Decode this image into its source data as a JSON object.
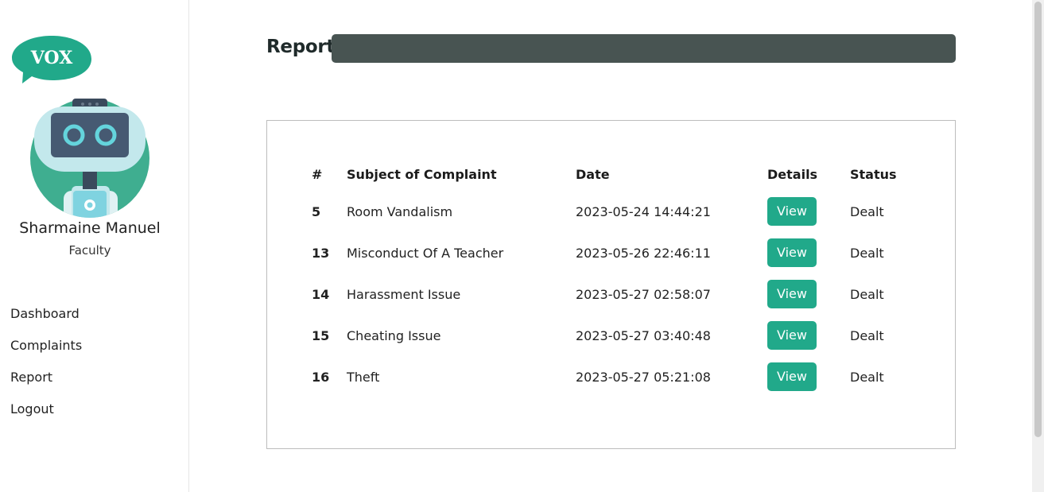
{
  "sidebar": {
    "logo_text": "VOX",
    "user_name": "Sharmaine Manuel",
    "user_role": "Faculty",
    "nav": [
      "Dashboard",
      "Complaints",
      "Report",
      "Logout"
    ]
  },
  "main": {
    "title": "Report",
    "table": {
      "headers": [
        "#",
        "Subject of Complaint",
        "Date",
        "Details",
        "Status"
      ],
      "rows": [
        {
          "id": "5",
          "subject": "Room Vandalism",
          "date": "2023-05-24 14:44:21",
          "details": "View",
          "status": "Dealt"
        },
        {
          "id": "13",
          "subject": "Misconduct Of A Teacher",
          "date": "2023-05-26 22:46:11",
          "details": "View",
          "status": "Dealt"
        },
        {
          "id": "14",
          "subject": "Harassment Issue",
          "date": "2023-05-27 02:58:07",
          "details": "View",
          "status": "Dealt"
        },
        {
          "id": "15",
          "subject": "Cheating Issue",
          "date": "2023-05-27 03:40:48",
          "details": "View",
          "status": "Dealt"
        },
        {
          "id": "16",
          "subject": "Theft",
          "date": "2023-05-27 05:21:08",
          "details": "View",
          "status": "Dealt"
        }
      ]
    }
  },
  "colors": {
    "accent": "#21a98a",
    "title_bar": "#485452"
  }
}
